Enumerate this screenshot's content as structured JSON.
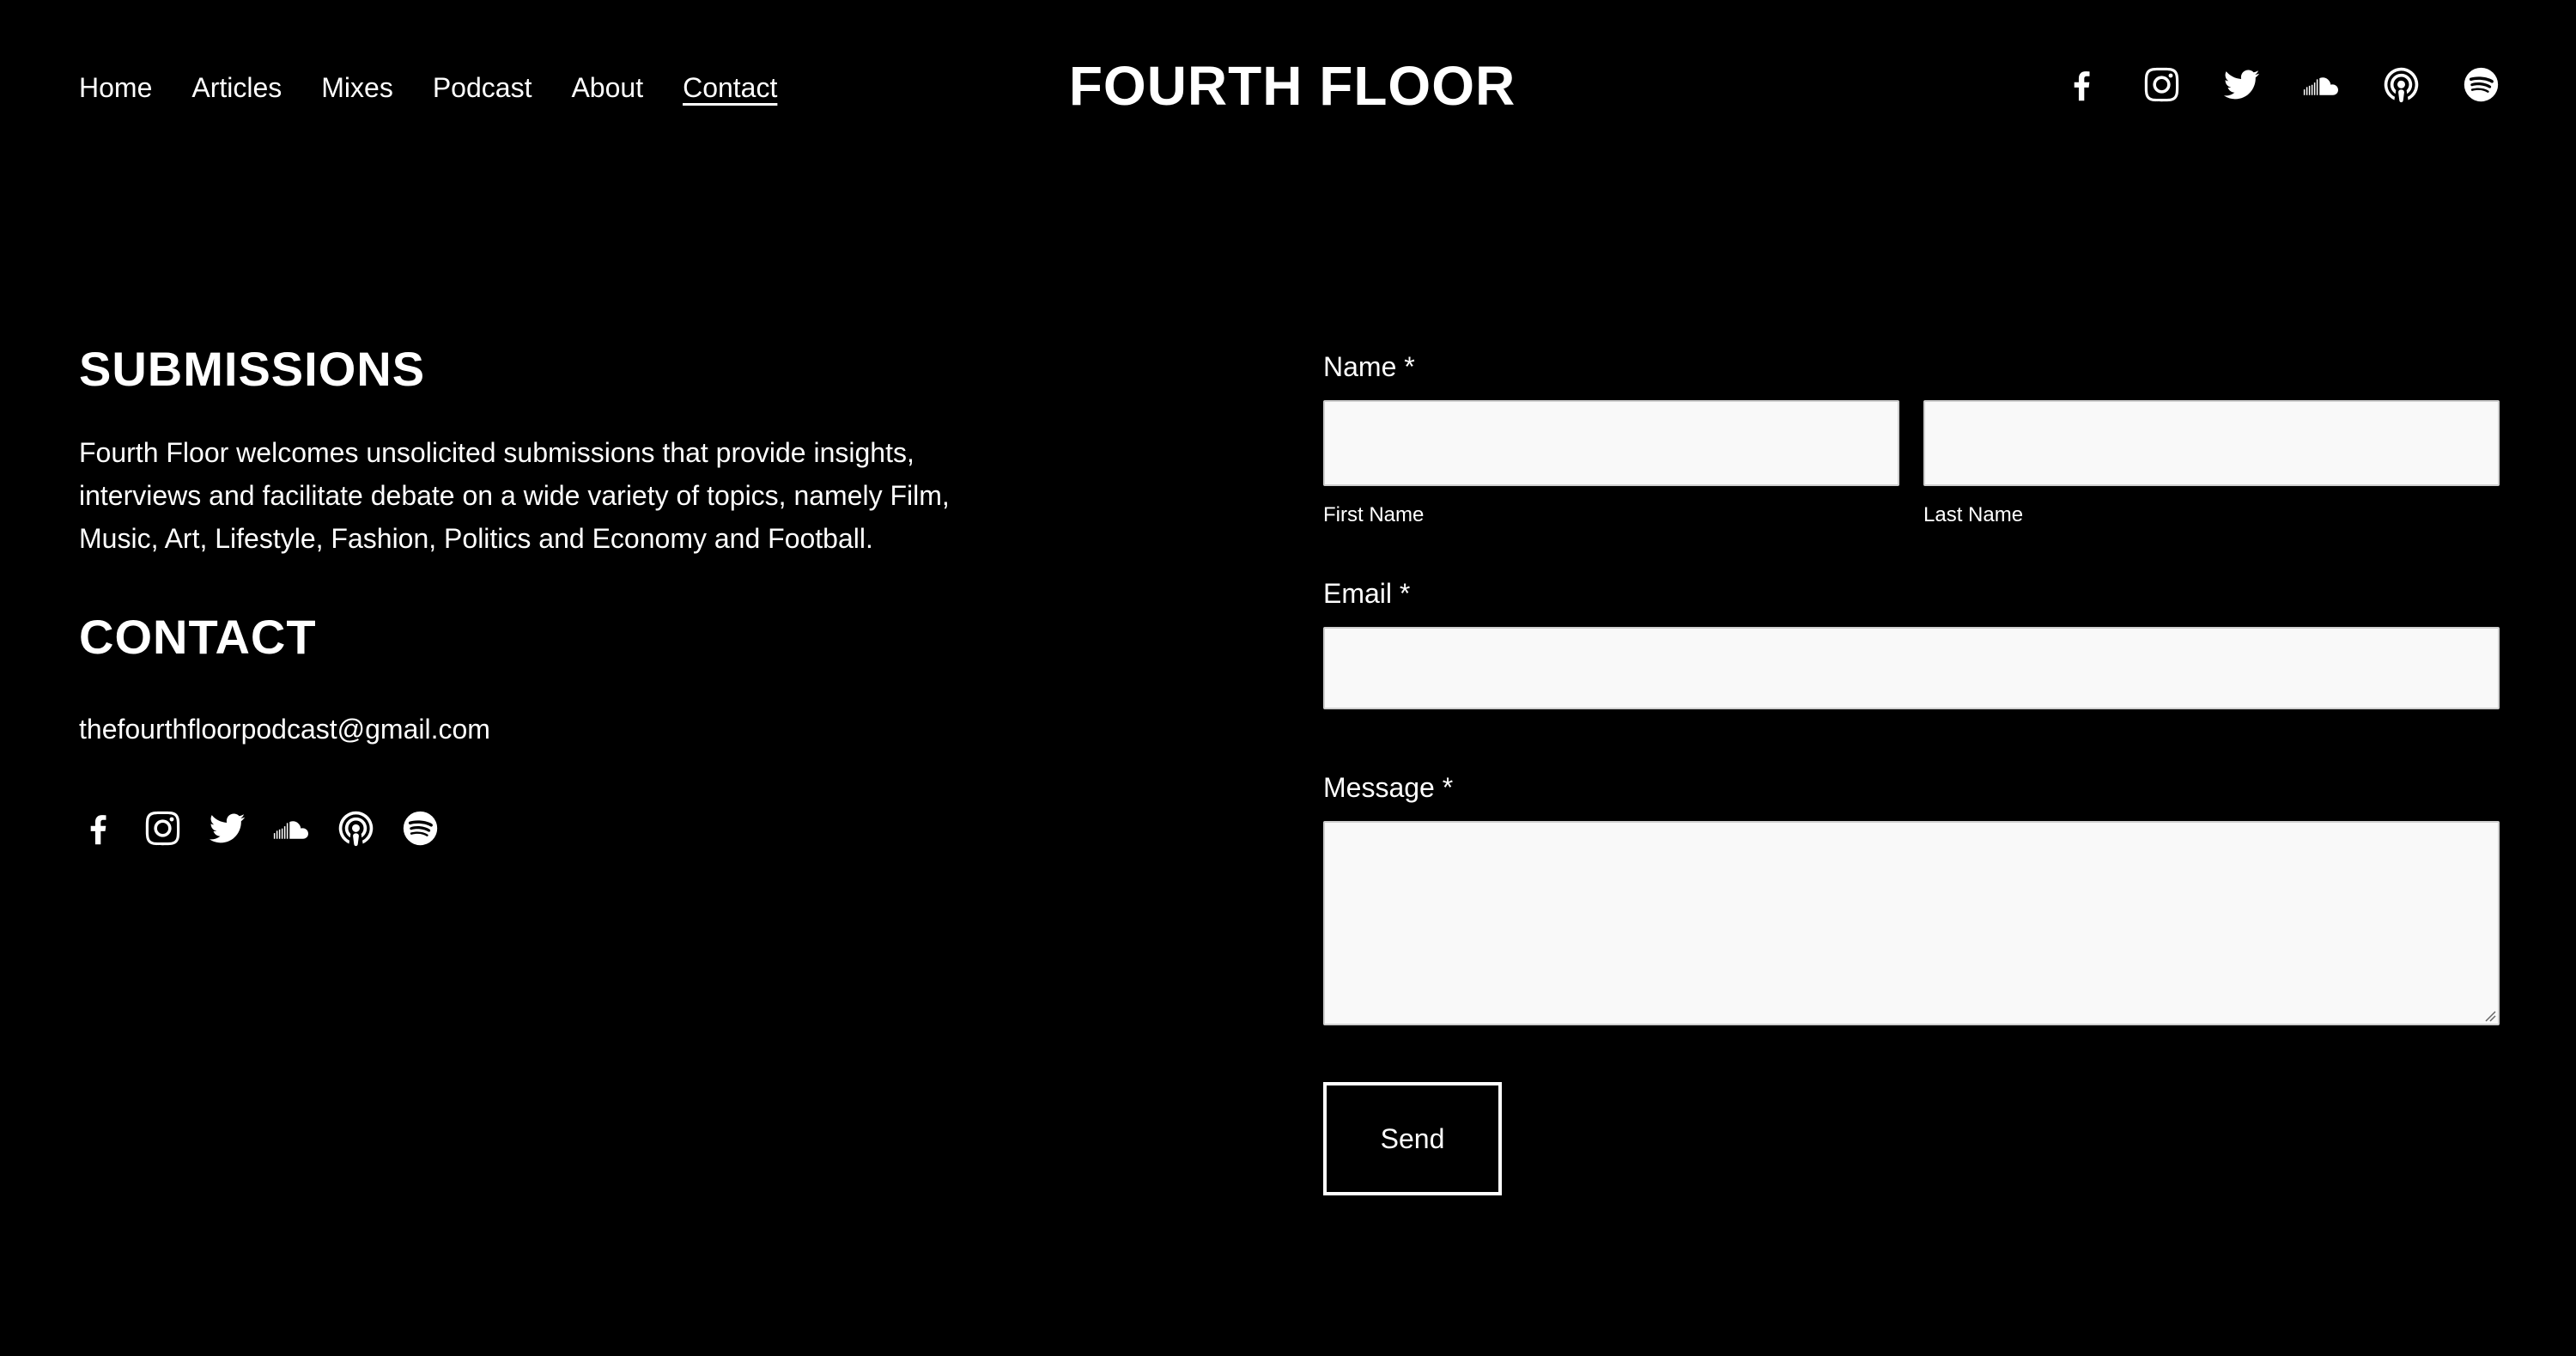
{
  "nav": {
    "items": [
      {
        "label": "Home",
        "active": false
      },
      {
        "label": "Articles",
        "active": false
      },
      {
        "label": "Mixes",
        "active": false
      },
      {
        "label": "Podcast",
        "active": false
      },
      {
        "label": "About",
        "active": false
      },
      {
        "label": "Contact",
        "active": true
      }
    ]
  },
  "site": {
    "logo": "FOURTH FLOOR"
  },
  "social_icons": [
    "facebook-icon",
    "instagram-icon",
    "twitter-icon",
    "soundcloud-icon",
    "podcast-icon",
    "spotify-icon"
  ],
  "submissions": {
    "heading": "SUBMISSIONS",
    "body": "Fourth Floor welcomes unsolicited submissions that provide insights, interviews and facilitate debate on a wide variety of topics, namely Film, Music, Art, Lifestyle, Fashion, Politics and Economy and Football."
  },
  "contact": {
    "heading": "CONTACT",
    "email": "thefourthfloorpodcast@gmail.com"
  },
  "form": {
    "name_label": "Name *",
    "first_name_label": "First Name",
    "first_name_value": "",
    "last_name_label": "Last Name",
    "last_name_value": "",
    "email_label": "Email *",
    "email_value": "",
    "message_label": "Message *",
    "message_value": "",
    "send_label": "Send"
  },
  "colors": {
    "background": "#000000",
    "text": "#ffffff",
    "input_bg": "#f9f9f9"
  }
}
